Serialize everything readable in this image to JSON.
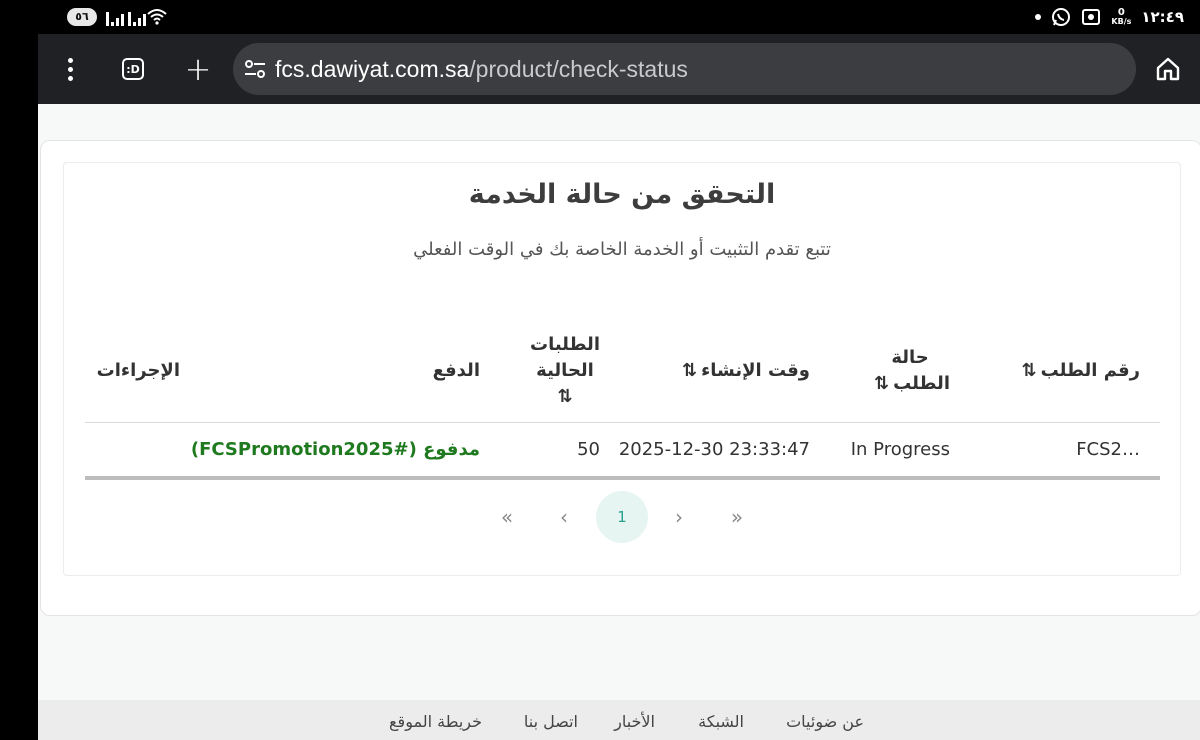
{
  "status_bar": {
    "sim_label": "٥٦",
    "clock": "١٢:٤٩",
    "speed_value": "0",
    "speed_unit": "KB/s"
  },
  "browser": {
    "tab_count_label": ":D",
    "url_domain": "fcs.dawiyat.com.sa",
    "url_path": "/product/check-status"
  },
  "page": {
    "title": "التحقق من حالة الخدمة",
    "subtitle": "تتبع تقدم التثبيت أو الخدمة الخاصة بك في الوقت الفعلي",
    "table": {
      "headers": {
        "order_number": "رقم الطلب",
        "order_status_line1": "حالة",
        "order_status_line2": "الطلب",
        "created_at": "وقت الإنشاء",
        "current_requests_line1": "الطلبات",
        "current_requests_line2": "الحالية",
        "payment": "الدفع",
        "actions": "الإجراءات"
      },
      "sort_glyph": "⇅",
      "rows": [
        {
          "order_number": "FCS2…",
          "status": "In Progress",
          "created_at": "2025-12-30 23:33:47",
          "current_requests": "50",
          "payment": "مدفوع (#FCSPromotion2025)"
        }
      ]
    },
    "pagination": {
      "first": "«",
      "prev": "‹",
      "current": "1",
      "next": "›",
      "last": "»"
    }
  },
  "footer": {
    "links": [
      "عن ضوئيات",
      "الشبكة",
      "الأخبار",
      "اتصل بنا",
      "خريطة الموقع"
    ]
  },
  "colors": {
    "accent": "#2aa18f",
    "paid": "#1f7a1f",
    "toolbar": "#202124"
  }
}
